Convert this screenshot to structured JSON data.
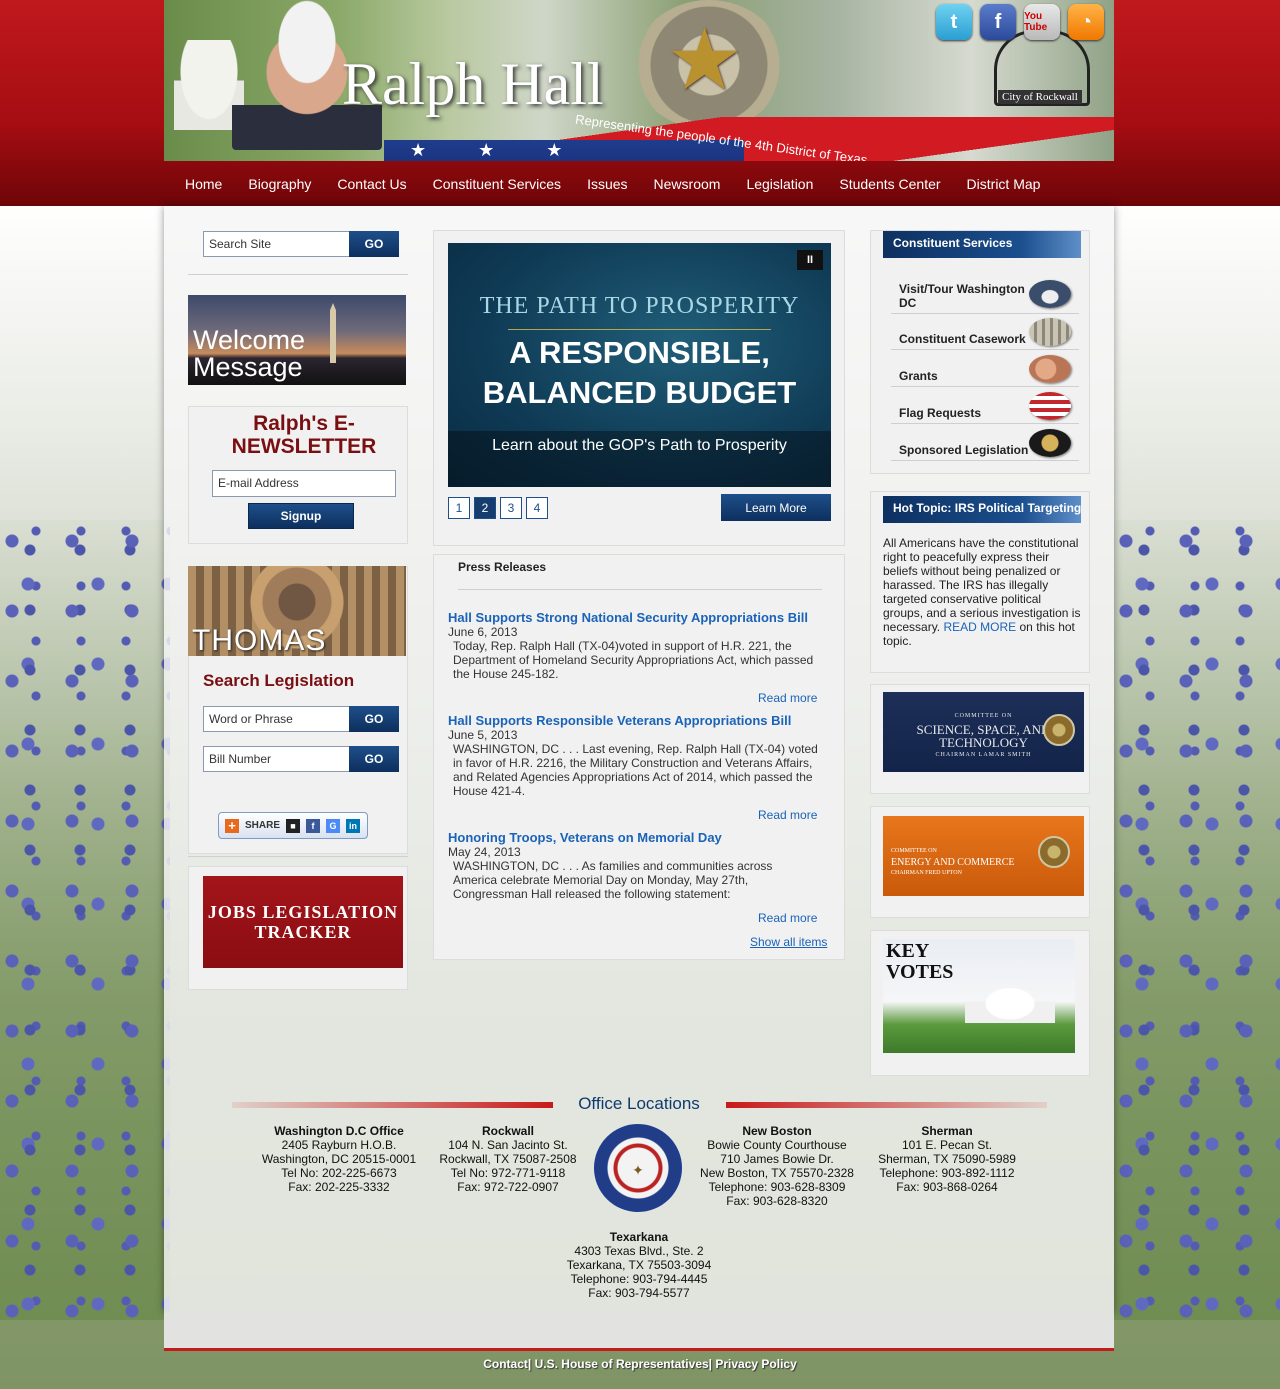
{
  "header": {
    "title": "Ralph Hall",
    "tagline": "Representing the people of the 4th District of Texas",
    "rockwall_sign": "City of Rockwall",
    "social": [
      {
        "name": "twitter",
        "glyph": "t"
      },
      {
        "name": "facebook",
        "glyph": "f"
      },
      {
        "name": "youtube",
        "glyph": "You Tube"
      },
      {
        "name": "rss",
        "glyph": "◔"
      }
    ]
  },
  "nav": [
    "Home",
    "Biography",
    "Contact Us",
    "Constituent Services",
    "Issues",
    "Newsroom",
    "Legislation",
    "Students Center",
    "District Map"
  ],
  "left": {
    "search_placeholder": "Search Site",
    "go": "GO",
    "welcome": "Welcome Message",
    "enewsletter_title": "Ralph's E-NEWSLETTER",
    "email_placeholder": "E-mail Address",
    "signup": "Signup",
    "thomas": "THOMAS",
    "search_legislation": "Search Legislation",
    "word_placeholder": "Word or Phrase",
    "bill_placeholder": "Bill Number",
    "share": "SHARE",
    "jobs_tracker": "JOBS LEGISLATION TRACKER"
  },
  "slider": {
    "line1": "THE PATH TO PROSPERITY",
    "line2": "A RESPONSIBLE, BALANCED BUDGET",
    "caption": "Learn about the GOP's Path to Prosperity",
    "pages": [
      "1",
      "2",
      "3",
      "4"
    ],
    "active_page": 2,
    "learn_more": "Learn More",
    "pause": "II"
  },
  "press": {
    "title": "Press Releases",
    "items": [
      {
        "headline": "Hall Supports Strong National Security Appropriations Bill",
        "date": "June 6, 2013",
        "body": "Today, Rep. Ralph Hall (TX-04)voted in support of H.R. 221, the Department of Homeland Security Appropriations Act, which passed the House 245-182."
      },
      {
        "headline": "Hall Supports Responsible Veterans Appropriations Bill",
        "date": "June 5, 2013",
        "body": "WASHINGTON, DC . . . Last evening, Rep. Ralph Hall (TX-04) voted in favor of H.R. 2216, the Military Construction and Veterans Affairs, and Related Agencies Appropriations Act of 2014, which passed the House 421-4."
      },
      {
        "headline": "Honoring Troops, Veterans on Memorial Day",
        "date": "May 24, 2013",
        "body": "WASHINGTON, DC . . . As families and communities across America celebrate Memorial Day on Monday, May 27th, Congressman Hall released the following statement:"
      }
    ],
    "read_more": "Read more",
    "show_all": "Show all items"
  },
  "right": {
    "cs_title": "Constituent Services",
    "cs_items": [
      "Visit/Tour Washington DC",
      "Constituent Casework",
      "Grants",
      "Flag Requests",
      "Sponsored Legislation"
    ],
    "hot_title": "Hot Topic: IRS Political Targeting",
    "hot_text": "All Americans have the constitutional right to peacefully express their beliefs without being penalized or harassed. The IRS has illegally targeted conservative political groups, and a serious investigation is necessary.",
    "hot_read": "READ MORE",
    "hot_tail": " on this hot topic.",
    "sst_small": "COMMITTEE ON",
    "sst_title": "SCIENCE, SPACE, AND TECHNOLOGY",
    "sst_chair": "CHAIRMAN LAMAR SMITH",
    "enc_small": "COMMITTEE ON",
    "enc_title": "ENERGY AND COMMERCE",
    "enc_chair": "CHAIRMAN FRED UPTON",
    "key_votes": "KEY VOTES"
  },
  "offices": {
    "title": "Office Locations",
    "seal_text": "U.S. HOUSE OF REPRESENTATIVES",
    "list": [
      {
        "name": "Washington D.C Office",
        "lines": [
          "2405 Rayburn H.O.B.",
          "Washington, DC 20515-0001",
          "Tel No: 202-225-6673",
          "Fax: 202-225-3332"
        ]
      },
      {
        "name": "Rockwall",
        "lines": [
          "104 N. San Jacinto St.",
          "Rockwall, TX 75087-2508",
          "Tel No: 972-771-9118",
          "Fax: 972-722-0907"
        ]
      },
      {
        "name": "New Boston",
        "lines": [
          "Bowie County Courthouse",
          "710 James Bowie Dr.",
          "New Boston, TX 75570-2328",
          "Telephone: 903-628-8309",
          "Fax: 903-628-8320"
        ]
      },
      {
        "name": "Sherman",
        "lines": [
          "101 E. Pecan St.",
          "Sherman, TX 75090-5989",
          "Telephone: 903-892-1112",
          "Fax: 903-868-0264"
        ]
      },
      {
        "name": "Texarkana",
        "lines": [
          "4303 Texas Blvd., Ste. 2",
          "Texarkana, TX 75503-3094",
          "Telephone: 903-794-4445",
          "Fax: 903-794-5577"
        ]
      }
    ]
  },
  "footer": {
    "links": [
      "Contact",
      "U.S. House of Representatives",
      "Privacy Policy"
    ],
    "separator": "|"
  },
  "colors": {
    "brand_red": "#a50d12",
    "nav_blue": "#0d2f5e",
    "link_blue": "#1a63b8",
    "heading_maroon": "#7a0f12"
  }
}
